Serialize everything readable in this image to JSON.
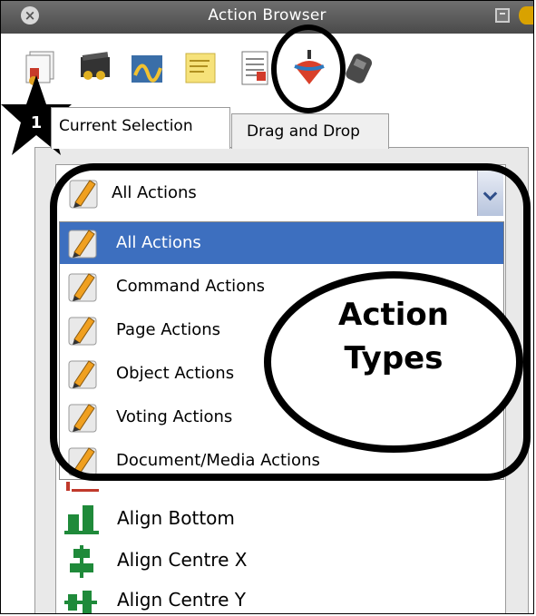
{
  "window": {
    "title": "Action Browser"
  },
  "toolbar": {
    "icons": [
      "gallery-icon",
      "multimedia-icon",
      "handwriting-icon",
      "notes-icon",
      "properties-icon",
      "spinning-top-icon",
      "device-icon"
    ]
  },
  "badge": {
    "number": "1"
  },
  "tabs": [
    {
      "label": "Current Selection"
    },
    {
      "label": "Drag and Drop"
    }
  ],
  "combo": {
    "selected": "All Actions"
  },
  "dropdown": {
    "items": [
      {
        "label": "All Actions",
        "selected": true
      },
      {
        "label": "Command Actions"
      },
      {
        "label": "Page Actions"
      },
      {
        "label": "Object Actions"
      },
      {
        "label": "Voting Actions"
      },
      {
        "label": "Document/Media Actions"
      }
    ]
  },
  "list": {
    "items": [
      {
        "label": "Align Bottom"
      },
      {
        "label": "Align Centre X"
      },
      {
        "label": "Align Centre Y"
      }
    ]
  },
  "callout": {
    "line1": "Action",
    "line2": "Types"
  },
  "colors": {
    "selection": "#3d6fbf",
    "titlebar": "#5a5a5a",
    "align_icon": "#1f8a3a"
  }
}
